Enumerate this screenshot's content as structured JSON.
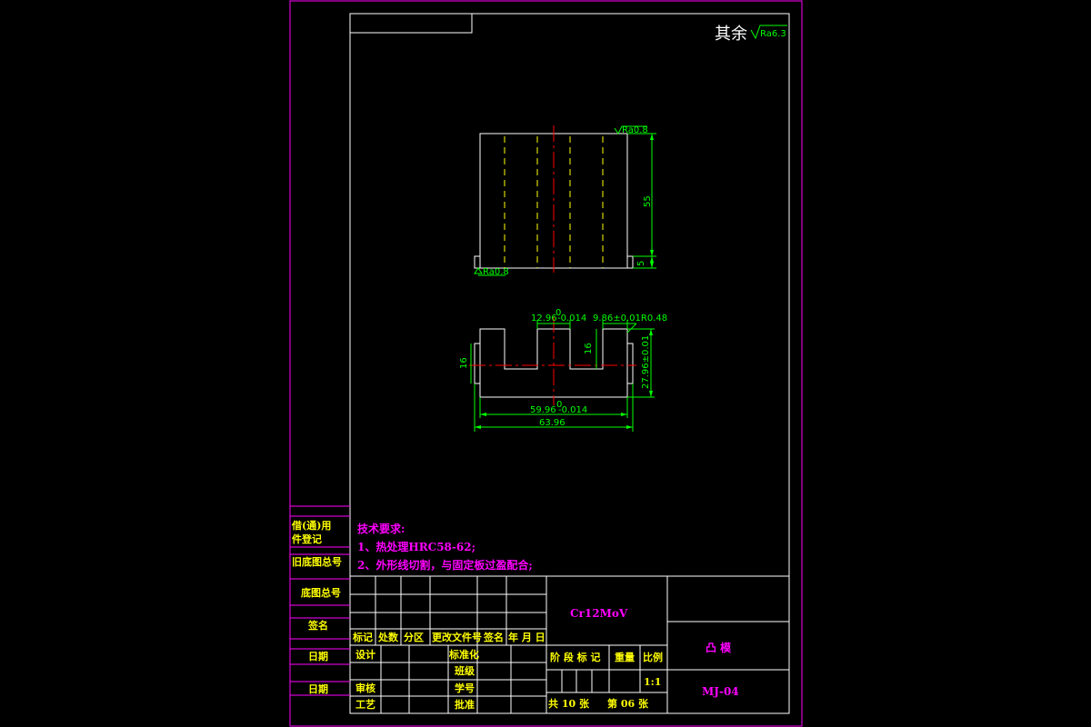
{
  "surface": {
    "default_mark": "其余",
    "default_value": "Ra6.3",
    "top_value": "Ra0.8",
    "bottom_value": "Ra0.8"
  },
  "front_view": {
    "dim_height": "55",
    "dim_step": "5"
  },
  "top_view": {
    "dim_slot_left": "12.96",
    "dim_slot_left_tol_upper": "0",
    "dim_slot_left_tol_lower": "-0.014",
    "dim_slot_right": "9.86±0.01R0.48",
    "dim_depth_left": "16",
    "dim_depth_mid": "16",
    "dim_height": "27.96±0.01",
    "dim_width_inner": "59.96",
    "dim_width_inner_tol_upper": "0",
    "dim_width_inner_tol_lower": "-0.014",
    "dim_width_outer": "63.96"
  },
  "tech": {
    "title": "技术要求:",
    "line1": "1、热处理HRC58-62;",
    "line2": "2、外形线切割，与固定板过盈配合;"
  },
  "side_labels": {
    "l1": "借(通)用",
    "l2": "件登记",
    "l3": "旧底图总号",
    "l4": "底图总号",
    "l5": "签名",
    "l6": "日期",
    "l7": "日期"
  },
  "title_block": {
    "material": "Cr12MoV",
    "part_name": "凸  模",
    "drawing_no": "MJ-04",
    "rev_headers": [
      "标记",
      "处数",
      "分区",
      "更改文件号",
      "签名",
      "年 月 日"
    ],
    "design": "设计",
    "standardize": "标准化",
    "class": "班级",
    "review": "审核",
    "student_no": "学号",
    "process": "工艺",
    "approve": "批准",
    "stage": "阶 段 标 记",
    "weight": "重量",
    "scale": "比例",
    "scale_value": "1:1",
    "total_sheets": "共 10 张",
    "sheet_no": "第 06 张"
  }
}
